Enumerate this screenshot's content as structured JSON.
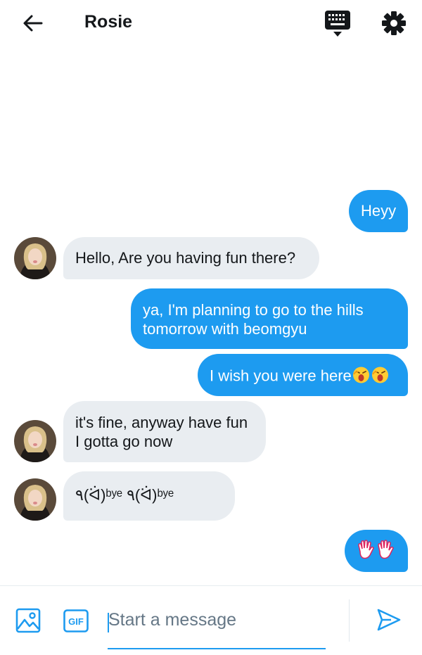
{
  "header": {
    "title": "Rosie",
    "icons": [
      "back-arrow-icon",
      "keyboard-icon",
      "gear-icon"
    ]
  },
  "messages": [
    {
      "side": "sent",
      "text": "Heyy"
    },
    {
      "side": "received",
      "text": "Hello, Are you having fun there?"
    },
    {
      "side": "sent",
      "text": "ya, I'm planning to go to the hills\ntomorrow with beomgyu"
    },
    {
      "side": "sent",
      "text": "I wish you were here",
      "emojis": [
        "screaming-face-emoji",
        "screaming-face-emoji"
      ]
    },
    {
      "side": "received",
      "text": "it's fine, anyway have fun\nI gotta go now"
    },
    {
      "side": "received",
      "text": "٩(ᐛ)ᵇʸᵉ ٩(ᐛ)ᵇʸᵉ"
    },
    {
      "side": "sent",
      "text": "",
      "emojis": [
        "waving-hand-emoji",
        "waving-hand-emoji"
      ]
    }
  ],
  "composer": {
    "placeholder": "Start a message",
    "gif_label": "GIF",
    "icons": [
      "image-icon",
      "gif-icon",
      "send-icon"
    ]
  },
  "colors": {
    "accent": "#1d9bf0",
    "received_bubble": "#e9edf1",
    "text": "#14171a",
    "placeholder": "#657786"
  }
}
